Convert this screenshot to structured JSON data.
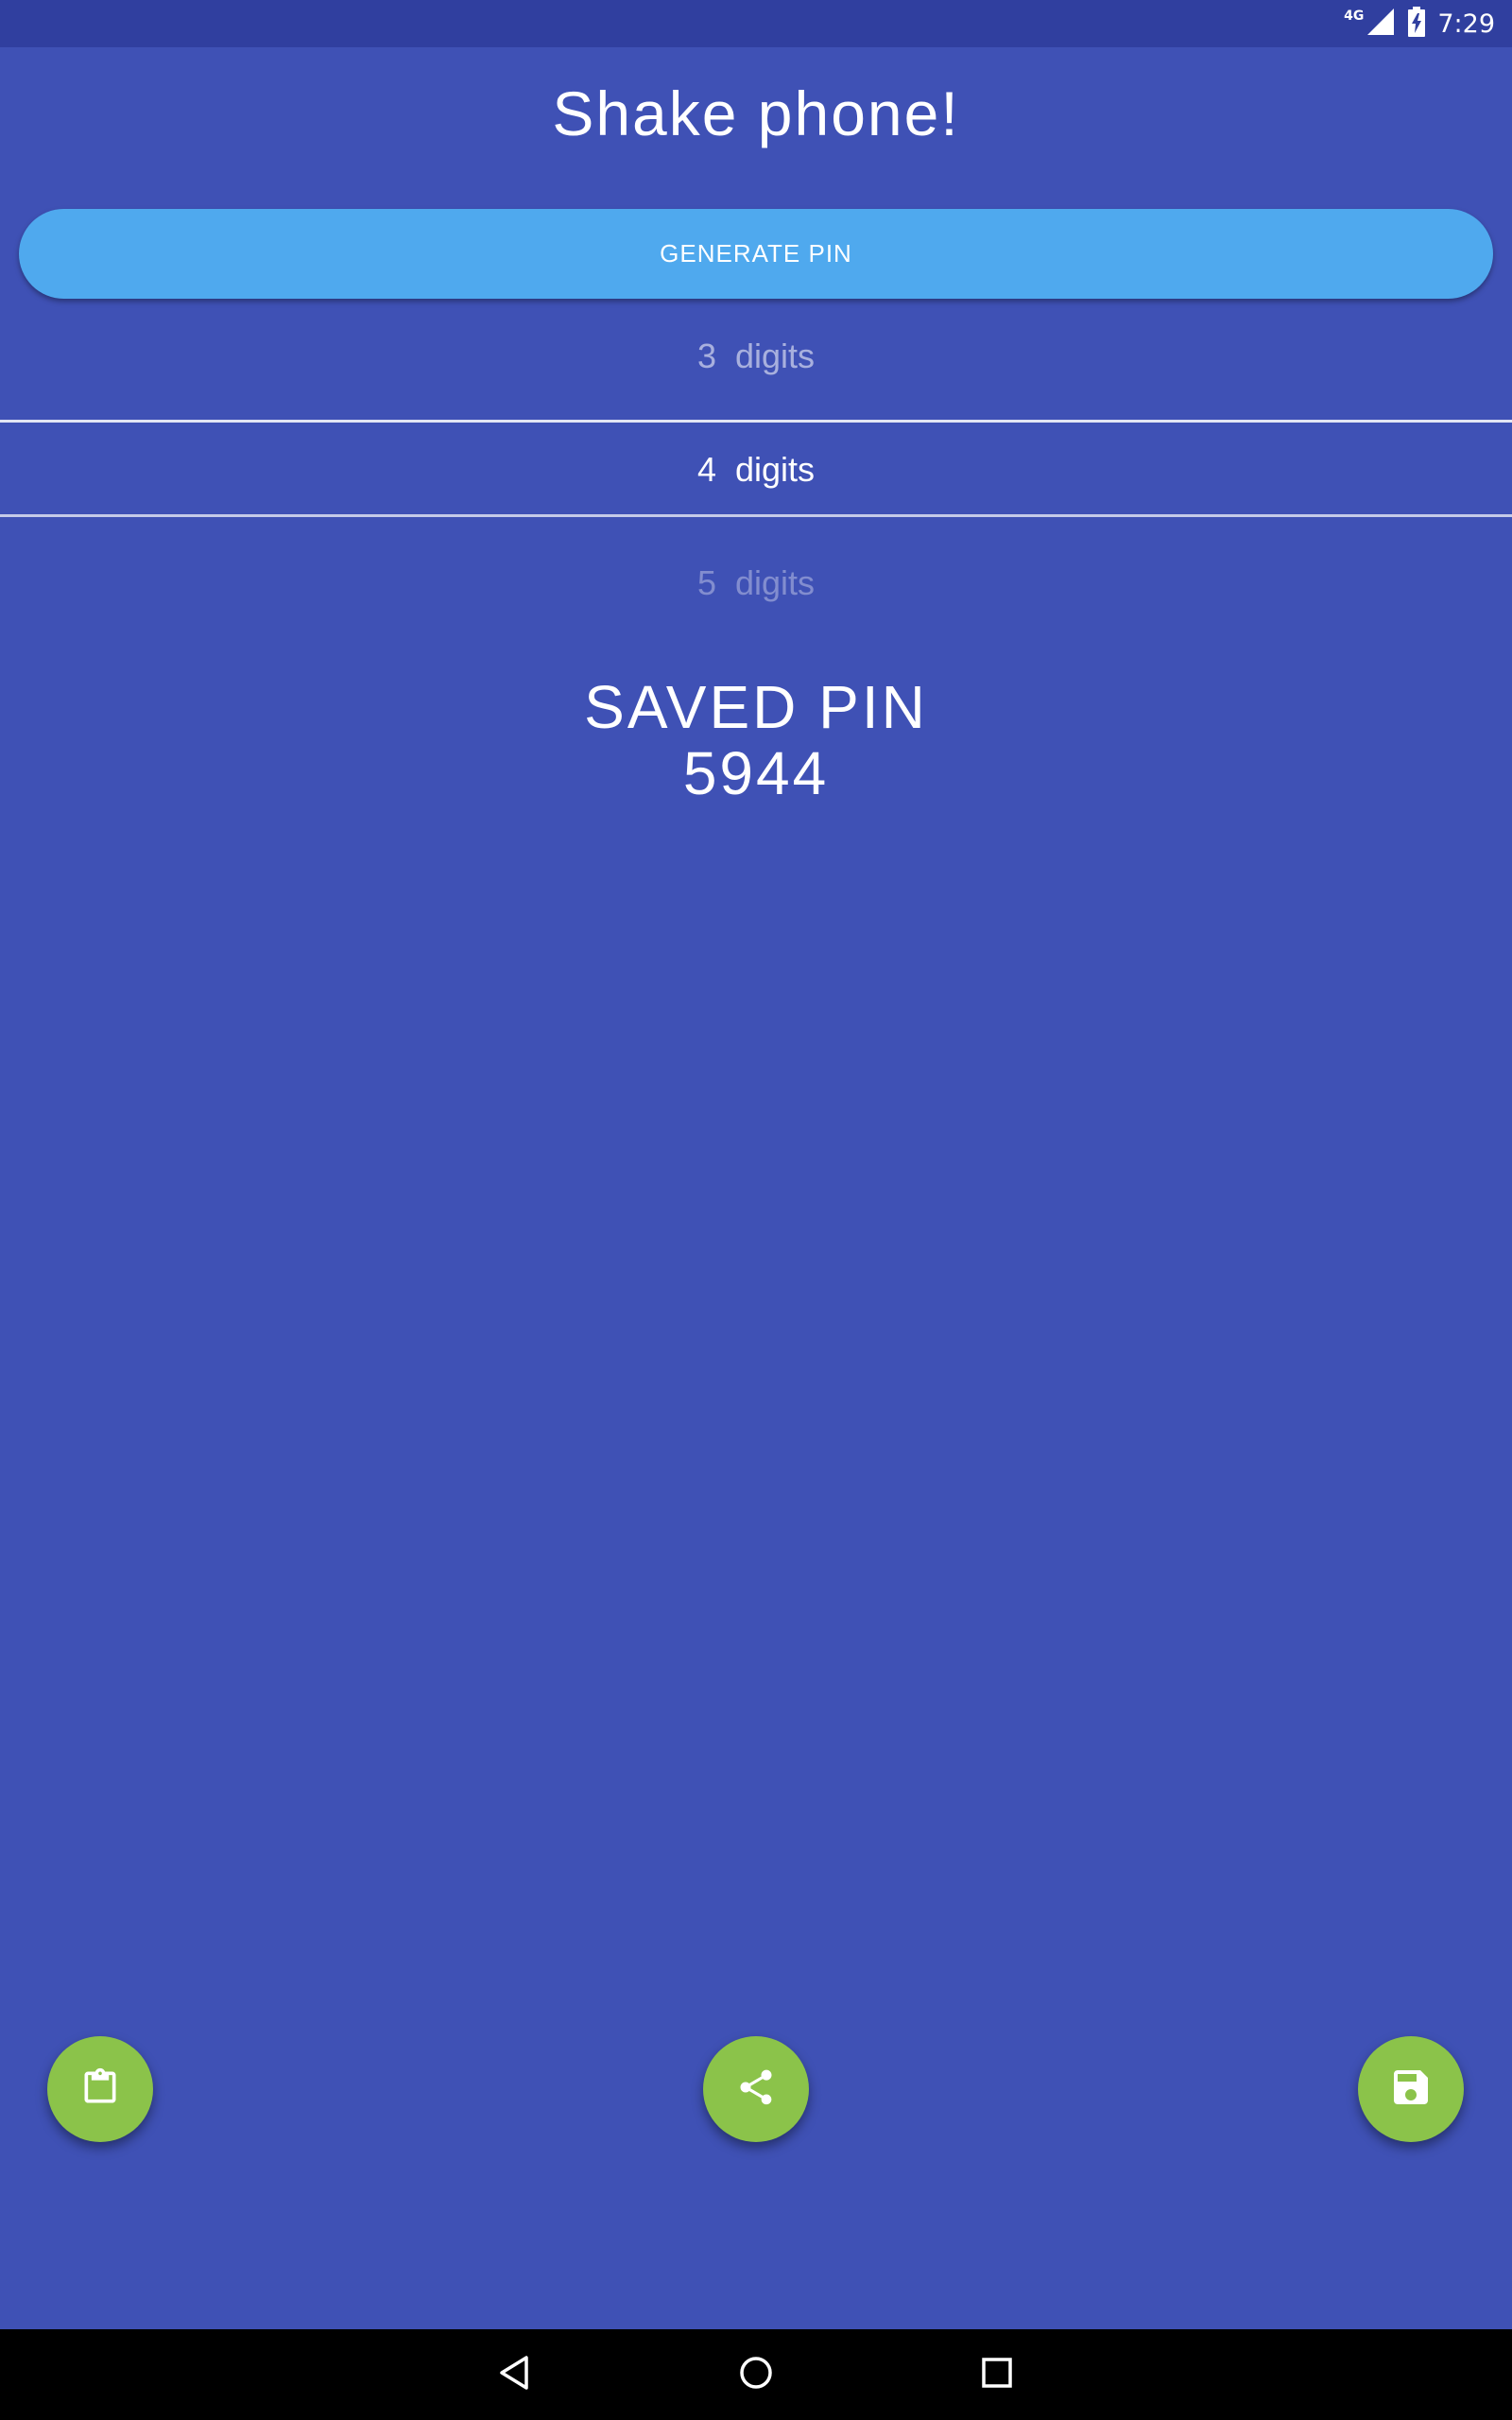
{
  "status_bar": {
    "network_label": "4G",
    "time": "7:29",
    "icons": [
      "signal-icon",
      "battery-charging-icon"
    ]
  },
  "title": "Shake phone!",
  "generate_button": {
    "label": "GENERATE PIN"
  },
  "digit_picker": {
    "prev": "3  digits",
    "current": "4  digits",
    "next": "5  digits"
  },
  "saved_pin": {
    "label": "SAVED PIN",
    "value": "5944"
  },
  "fabs": {
    "clipboard_icon": "clipboard-icon",
    "share_icon": "share-icon",
    "save_icon": "save-icon"
  },
  "nav_bar": {
    "icons": [
      "back-icon",
      "home-icon",
      "recents-icon"
    ]
  },
  "colors": {
    "background": "#3f51b5",
    "status_bar": "#303f9f",
    "button": "#4fa9ee",
    "fab": "#8bc34a"
  }
}
